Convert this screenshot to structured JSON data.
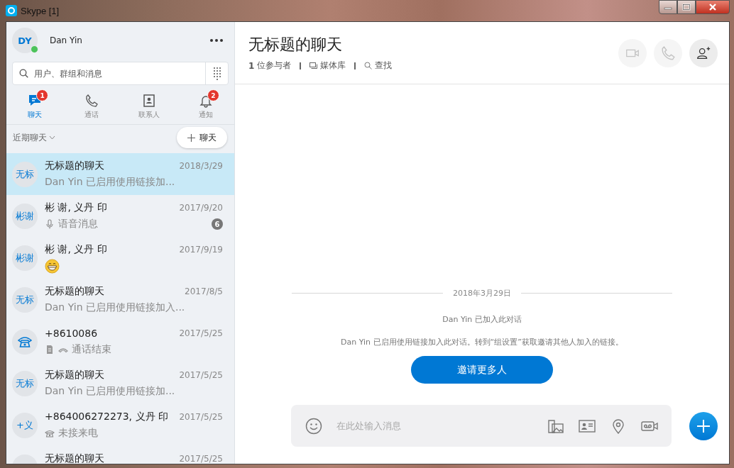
{
  "window": {
    "title": "Skype [1]"
  },
  "profile": {
    "initials": "DY",
    "name": "Dan Yin",
    "online": true
  },
  "search": {
    "placeholder": "用户、群组和消息"
  },
  "nav_tabs": [
    {
      "kind": "chat",
      "label": "聊天",
      "badge": "1",
      "selected": true
    },
    {
      "kind": "call",
      "label": "通话",
      "selected": false
    },
    {
      "kind": "contacts",
      "label": "联系人",
      "selected": false
    },
    {
      "kind": "notify",
      "label": "通知",
      "badge": "2",
      "selected": false
    }
  ],
  "recent": {
    "label": "近期聊天",
    "new_chat": "聊天"
  },
  "chats": [
    {
      "avatar": {
        "kind": "text",
        "label": "无标"
      },
      "title": "无标题的聊天",
      "date": "2018/3/29",
      "preview": {
        "kind": "text",
        "text": "Dan Yin 已启用使用链接加..."
      },
      "selected": true
    },
    {
      "avatar": {
        "kind": "text",
        "label": "彬谢"
      },
      "title": "彬 谢, 义丹 印",
      "date": "2017/9/20",
      "preview": {
        "kind": "voice",
        "text": "语音消息"
      },
      "unread": "6",
      "selected": false
    },
    {
      "avatar": {
        "kind": "text",
        "label": "彬谢"
      },
      "title": "彬 谢, 义丹 印",
      "date": "2017/9/19",
      "preview": {
        "kind": "emoji"
      },
      "selected": false
    },
    {
      "avatar": {
        "kind": "text",
        "label": "无标"
      },
      "title": "无标题的聊天",
      "date": "2017/8/5",
      "preview": {
        "kind": "text",
        "text": "Dan Yin 已启用使用链接加入..."
      },
      "selected": false
    },
    {
      "avatar": {
        "kind": "phone"
      },
      "title": "+8610086",
      "date": "2017/5/25",
      "preview": {
        "kind": "call_ended",
        "text": "通话结束"
      },
      "selected": false
    },
    {
      "avatar": {
        "kind": "text",
        "label": "无标"
      },
      "title": "无标题的聊天",
      "date": "2017/5/25",
      "preview": {
        "kind": "text",
        "text": "Dan Yin 已启用使用链接加..."
      },
      "selected": false
    },
    {
      "avatar": {
        "kind": "text",
        "label": "+义"
      },
      "title": "+864006272273, 义丹 印",
      "date": "2017/5/25",
      "preview": {
        "kind": "missed_call",
        "text": "未接来电"
      },
      "selected": false
    },
    {
      "avatar": {
        "kind": "text"
      },
      "title": "无标题的聊天",
      "date": "2017/5/25",
      "selected": false
    }
  ],
  "conversation": {
    "title": "无标题的聊天",
    "participants_count": "1",
    "participants_label": "位参与者",
    "gallery": "媒体库",
    "find": "查找",
    "actions": [
      {
        "kind": "video",
        "disabled": true
      },
      {
        "kind": "call",
        "disabled": true
      },
      {
        "kind": "add_person",
        "disabled": false
      }
    ]
  },
  "messages": {
    "date": "2018年3月29日",
    "events": [
      "Dan Yin 已加入此对话",
      "Dan Yin 已启用使用链接加入此对话。转到“组设置”获取邀请其他人加入的链接。"
    ],
    "invite_button": "邀请更多人"
  },
  "compose": {
    "placeholder": "在此处输入消息",
    "tools": [
      {
        "kind": "file"
      },
      {
        "kind": "contact"
      },
      {
        "kind": "location"
      },
      {
        "kind": "video_message"
      }
    ]
  }
}
